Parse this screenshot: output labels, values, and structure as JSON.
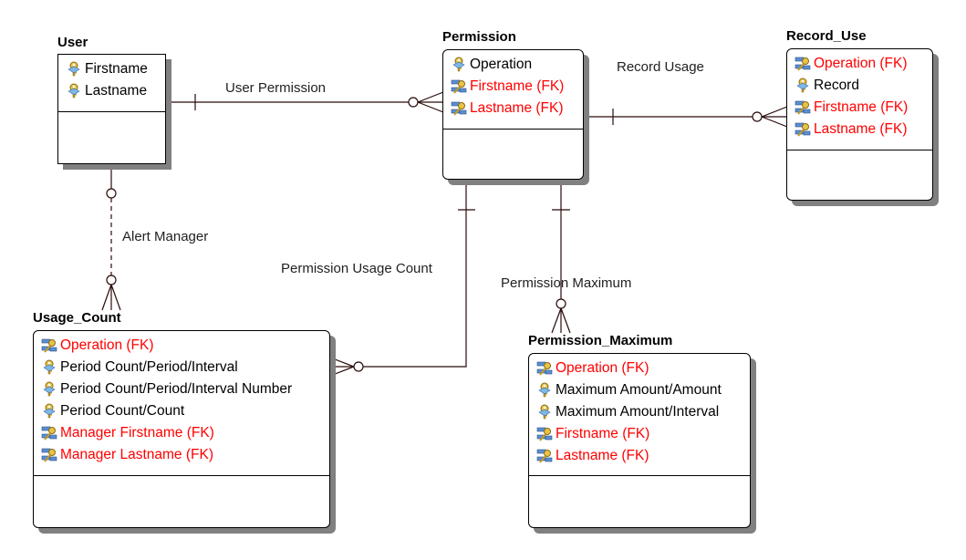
{
  "diagram": {
    "type": "entity-relationship",
    "colors": {
      "fk_text": "#ff0000",
      "pk_text": "#000000",
      "line": "#2b0a0a",
      "shadow": "#808080"
    },
    "entities": [
      {
        "id": "user",
        "name": "User",
        "attributes": [
          {
            "label": "Firstname",
            "kind": "pk",
            "icon": "primary-key-icon"
          },
          {
            "label": "Lastname",
            "kind": "pk",
            "icon": "primary-key-icon"
          }
        ]
      },
      {
        "id": "permission",
        "name": "Permission",
        "attributes": [
          {
            "label": "Operation",
            "kind": "pk",
            "icon": "primary-key-icon"
          },
          {
            "label": "Firstname (FK)",
            "kind": "fk",
            "icon": "foreign-key-icon"
          },
          {
            "label": "Lastname (FK)",
            "kind": "fk",
            "icon": "foreign-key-icon"
          }
        ]
      },
      {
        "id": "record_use",
        "name": "Record_Use",
        "attributes": [
          {
            "label": "Operation (FK)",
            "kind": "fk",
            "icon": "foreign-key-icon"
          },
          {
            "label": "Record",
            "kind": "pk",
            "icon": "primary-key-icon"
          },
          {
            "label": "Firstname (FK)",
            "kind": "fk",
            "icon": "foreign-key-icon"
          },
          {
            "label": "Lastname (FK)",
            "kind": "fk",
            "icon": "foreign-key-icon"
          }
        ]
      },
      {
        "id": "usage_count",
        "name": "Usage_Count",
        "attributes": [
          {
            "label": "Operation (FK)",
            "kind": "fk",
            "icon": "foreign-key-icon"
          },
          {
            "label": "Period Count/Period/Interval",
            "kind": "pk",
            "icon": "primary-key-icon"
          },
          {
            "label": "Period Count/Period/Interval Number",
            "kind": "pk",
            "icon": "primary-key-icon"
          },
          {
            "label": "Period Count/Count",
            "kind": "pk",
            "icon": "primary-key-icon"
          },
          {
            "label": "Manager Firstname (FK)",
            "kind": "fk",
            "icon": "foreign-key-icon"
          },
          {
            "label": "Manager Lastname (FK)",
            "kind": "fk",
            "icon": "foreign-key-icon"
          }
        ]
      },
      {
        "id": "permission_maximum",
        "name": "Permission_Maximum",
        "attributes": [
          {
            "label": "Operation (FK)",
            "kind": "fk",
            "icon": "foreign-key-icon"
          },
          {
            "label": "Maximum Amount/Amount",
            "kind": "pk",
            "icon": "primary-key-icon"
          },
          {
            "label": "Maximum Amount/Interval",
            "kind": "pk",
            "icon": "primary-key-icon"
          },
          {
            "label": "Firstname (FK)",
            "kind": "fk",
            "icon": "foreign-key-icon"
          },
          {
            "label": "Lastname (FK)",
            "kind": "fk",
            "icon": "foreign-key-icon"
          }
        ]
      }
    ],
    "relationships": [
      {
        "id": "user_permission",
        "label": "User Permission",
        "from": "User",
        "to": "Permission",
        "from_card": "one",
        "to_card": "zero-or-many",
        "style": "solid"
      },
      {
        "id": "record_usage",
        "label": "Record Usage",
        "from": "Permission",
        "to": "Record_Use",
        "from_card": "one",
        "to_card": "zero-or-many",
        "style": "solid"
      },
      {
        "id": "alert_manager",
        "label": "Alert Manager",
        "from": "User",
        "to": "Usage_Count",
        "from_card": "zero-or-one",
        "to_card": "zero-or-many",
        "style": "dashed"
      },
      {
        "id": "permission_usage_count",
        "label": "Permission Usage Count",
        "from": "Permission",
        "to": "Usage_Count",
        "from_card": "one",
        "to_card": "zero-or-many",
        "style": "solid"
      },
      {
        "id": "permission_maximum",
        "label": "Permission Maximum",
        "from": "Permission",
        "to": "Permission_Maximum",
        "from_card": "one",
        "to_card": "zero-or-many",
        "style": "solid"
      }
    ]
  }
}
